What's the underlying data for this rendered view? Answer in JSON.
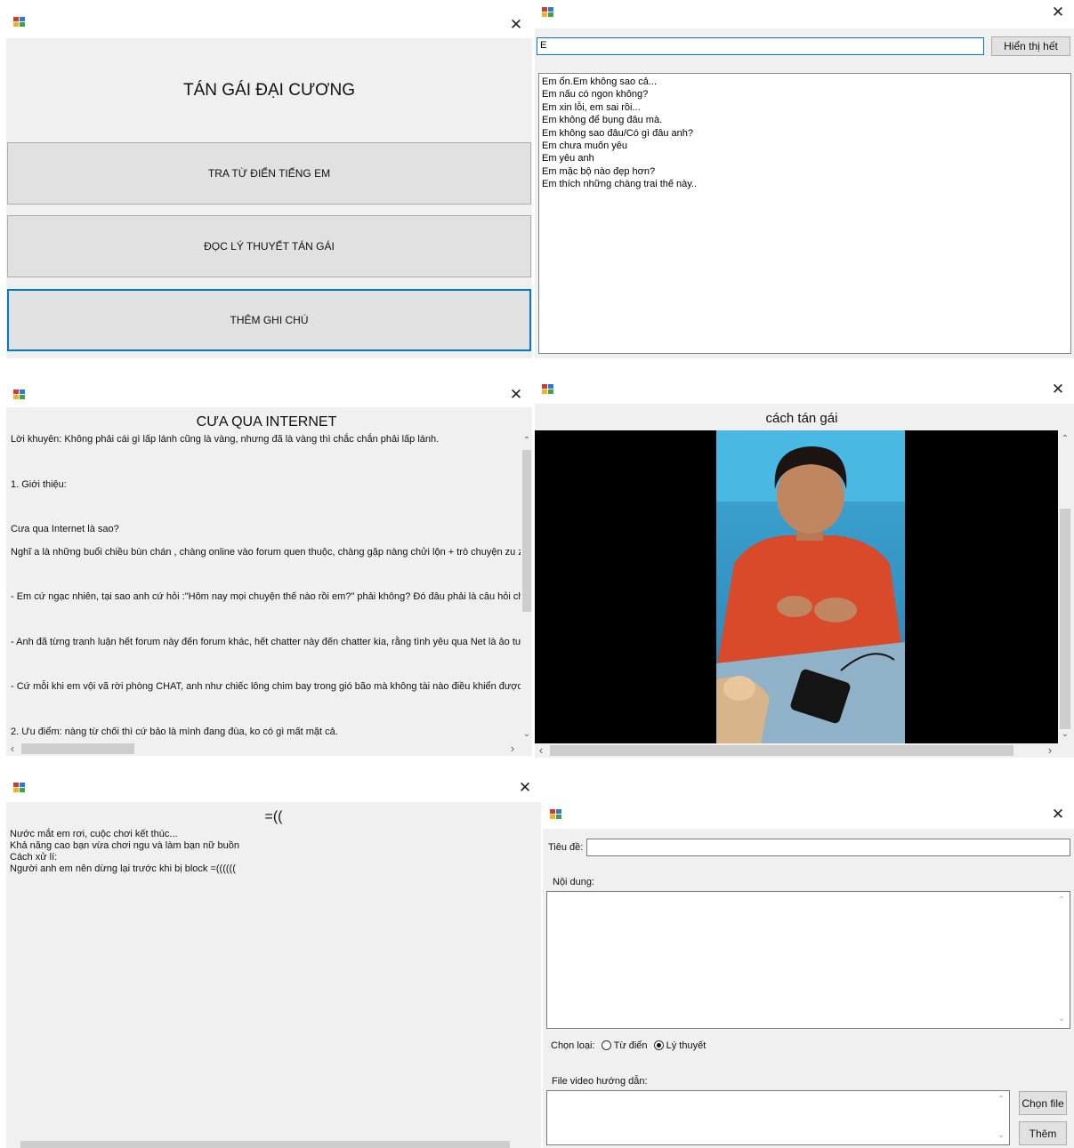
{
  "colors": {
    "window_bg": "#f0f0f0",
    "button_bg": "#e1e1e1",
    "focus_border": "#0078d7",
    "video_bg": "#000000"
  },
  "icons": {
    "app": "app-icon",
    "close": "close-icon"
  },
  "glyphs": {
    "close": "✕",
    "up": "⌃",
    "down": "⌄",
    "left": "‹",
    "right": "›"
  },
  "main_menu": {
    "title": "TÁN GÁI ĐẠI CƯƠNG",
    "buttons": [
      "TRA TỪ ĐIỂN TIẾNG EM",
      "ĐỌC LÝ THUYẾT TÁN GÁI",
      "THÊM GHI CHÚ"
    ]
  },
  "dictionary": {
    "search_value": "E",
    "show_all_label": "Hiển thị hết",
    "items": [
      "Em ổn.Em không sao cả...",
      "Em nấu có ngon không?",
      "Em xin lỗi, em sai rồi...",
      "Em không để bụng đâu mà.",
      "Em không sao đâu/Có gì đâu anh?",
      "Em chưa muốn yêu",
      "Em yêu anh",
      "Em mặc bộ nào đẹp hơn?",
      "Em thích những chàng trai thế này.."
    ]
  },
  "article": {
    "title": "CƯA QUA INTERNET",
    "lines": [
      "Lời khuyên: Không phải cái gì lấp lánh cũng là vàng, nhưng đã là vàng thì chắc chắn phải lấp lánh.",
      "1. Giới thiệu:",
      "Cưa qua Internet là sao?",
      "Nghĩ a là những buổi chiều bùn chán , chàng online vào forum quen thuộc,  chàng gặp nàng chửi lộn + trò chuyện zu zơ . Ou",
      "- Em cứ ngạc nhiên,  tại sao anh cứ hỏi :\"Hôm nay mọi chuyện thế nào rồi em?\" phải không? Đó  đâu phải là câu hỏi cho có.",
      "- Anh đã từng tranh luận hết  forum này đến forum khác, hết chatter này đến chatter kia, rằng tình  yêu qua Net là ảo tưởng, r",
      "-  Cứ mỗi khi em vội vã rời phòng CHAT, anh như chiếc lông chim bay trong  gió bão mà không tài nào điều khiển được hướn",
      "2. Ưu điểm: nàng từ chối thì cứ bảo là mình đang đùa, ko có gì mất mặt cả."
    ]
  },
  "video": {
    "title": "cách tán gái"
  },
  "sad": {
    "title": "=((",
    "lines": [
      "Nước mắt em rơi, cuộc chơi kết thúc...",
      "Khả năng cao bạn vừa chơi ngu và làm bạn nữ buồn",
      "Cách xử lí:",
      "Người anh em nên dừng lại trước khi bị block =(((((("
    ]
  },
  "note_form": {
    "title_label": "Tiêu đề:",
    "content_label": "Nội dung:",
    "type_label": "Chọn loại:",
    "option_dictionary": "Từ điển",
    "option_theory": "Lý thuyết",
    "selected": "Lý thuyết",
    "video_label": "File video hướng dẫn:",
    "choose_file_label": "Chọn file",
    "add_label": "Thêm"
  }
}
